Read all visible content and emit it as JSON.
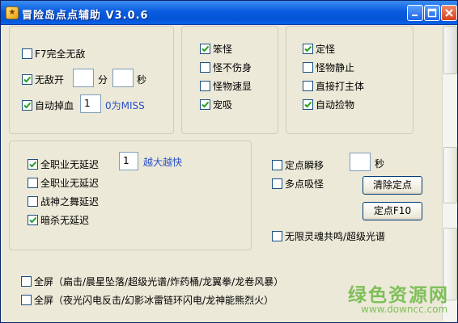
{
  "window": {
    "title": "冒险岛点点辅助 V3.0.6"
  },
  "group1": {
    "f7": {
      "label": "F7完全无敌",
      "checked": false
    },
    "invincible": {
      "label": "无敌开",
      "checked": true,
      "min_value": "",
      "min_unit": "分",
      "sec_value": "",
      "sec_unit": "秒"
    },
    "auto_hp": {
      "label": "自动掉血",
      "checked": true,
      "value": "1",
      "hint": "0为MISS"
    }
  },
  "group2": {
    "items": [
      {
        "label": "笨怪",
        "checked": true
      },
      {
        "label": "怪不伤身",
        "checked": false
      },
      {
        "label": "怪物速显",
        "checked": false
      },
      {
        "label": "宠吸",
        "checked": true
      }
    ]
  },
  "group3": {
    "items": [
      {
        "label": "定怪",
        "checked": true
      },
      {
        "label": "怪物静止",
        "checked": false
      },
      {
        "label": "直接打主体",
        "checked": false
      },
      {
        "label": "自动捡物",
        "checked": true
      }
    ]
  },
  "group4": {
    "items": [
      {
        "label": "全职业无延迟",
        "checked": true
      },
      {
        "label": "全职业无延迟",
        "checked": false
      },
      {
        "label": "战神之舞延迟",
        "checked": false
      },
      {
        "label": "暗杀无延迟",
        "checked": true
      }
    ],
    "speed_value": "1",
    "speed_hint": "越大越快"
  },
  "right": {
    "teleport": {
      "label": "定点瞬移",
      "checked": false,
      "sec_value": "",
      "sec_unit": "秒"
    },
    "multi_suck": {
      "label": "多点吸怪",
      "checked": false
    },
    "clear_btn": "清除定点",
    "set_btn": "定点F10",
    "soul": {
      "label": "无限灵魂共鸣/超级光谱",
      "checked": false
    }
  },
  "fullscreen": [
    {
      "label": "全屏（扁击/晨星坠落/超级光谱/炸药桶/龙翼拳/龙卷风暴）",
      "checked": false
    },
    {
      "label": "全屏（夜光闪电反击/幻影冰雷链环闪电/龙神能熊烈火）",
      "checked": false
    }
  ],
  "watermark": {
    "text": "绿色资源网",
    "url": "www.downcc.com"
  },
  "colors": {
    "title_bar": "#0a5ce0",
    "hint_text": "#2b50c8",
    "watermark": "#7fbf5a"
  }
}
